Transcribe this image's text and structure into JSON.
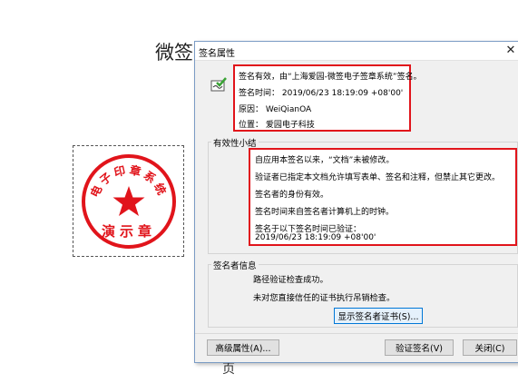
{
  "document": {
    "title_visible": "微签",
    "footer_char": "页"
  },
  "seal": {
    "top_text": "电子印章系统",
    "bottom_text": "演示章",
    "color": "#e1141b"
  },
  "dialog": {
    "title": "签名属性",
    "close_glyph": "✕",
    "summary": {
      "status": "签名有效，由“上海爱园-微签电子签章系统”签名。",
      "time": "签名时间：  2019/06/23 18:19:09 +08'00'",
      "reason": "原因：  WeiQianOA",
      "location": "位置：  爱园电子科技"
    },
    "validity": {
      "heading": "有效性小结",
      "lines": [
        "自应用本签名以来，“文档”未被修改。",
        "验证者已指定本文档允许填写表单、签名和注释，但禁止其它更改。",
        "签名者的身份有效。",
        "签名时间来自签名者计算机上的时钟。",
        "签名于以下签名时间已验证：",
        "2019/06/23 18:19:09 +08'00'"
      ]
    },
    "signer": {
      "heading": "签名者信息",
      "lines": [
        "路径验证检查成功。",
        "未对您直接信任的证书执行吊销检查。"
      ],
      "show_cert_button": "显示签名者证书(S)..."
    },
    "buttons": {
      "advanced": "高级属性(A)...",
      "verify": "验证签名(V)",
      "close": "关闭(C)"
    }
  },
  "colors": {
    "highlight": "#e1141b",
    "dialog_bg": "#f0f0f0",
    "focus_border": "#0078d7"
  }
}
